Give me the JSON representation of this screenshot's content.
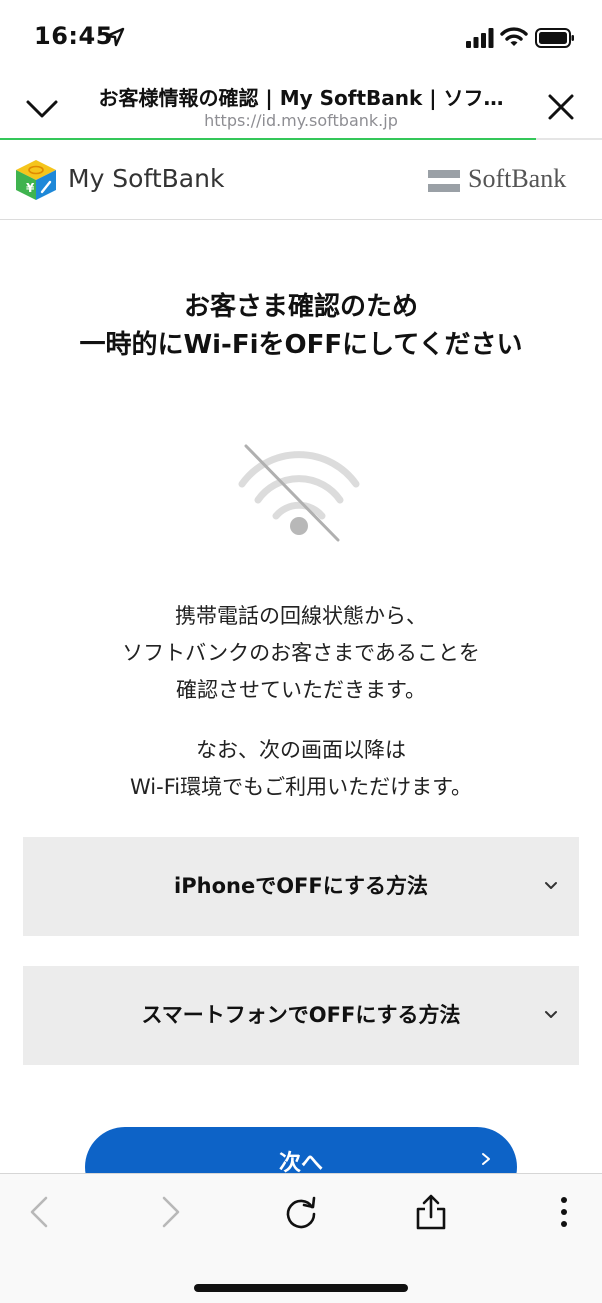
{
  "status_bar": {
    "time": "16:45"
  },
  "nav": {
    "title": "お客様情報の確認 | My SoftBank | ソフ…",
    "url": "https://id.my.softbank.jp",
    "load_progress": 0.89
  },
  "header": {
    "mysoftbank_label": "My SoftBank",
    "softbank_label": "SoftBank"
  },
  "main": {
    "headline_1": "お客さま確認のため",
    "headline_2": "一時的にWi-FiをOFFにしてください",
    "body_1_line_1": "携帯電話の回線状態から、",
    "body_1_line_2": "ソフトバンクのお客さまであることを",
    "body_1_line_3": "確認させていただきます。",
    "body_2_line_1": "なお、次の画面以降は",
    "body_2_line_2": "Wi-Fi環境でもご利用いただけます。",
    "accordion_iphone": "iPhoneでOFFにする方法",
    "accordion_smartphone": "スマートフォンでOFFにする方法",
    "next_button": "次へ"
  },
  "colors": {
    "primary": "#0d63c7",
    "progress": "#34c759",
    "accordion_bg": "#ececec"
  }
}
